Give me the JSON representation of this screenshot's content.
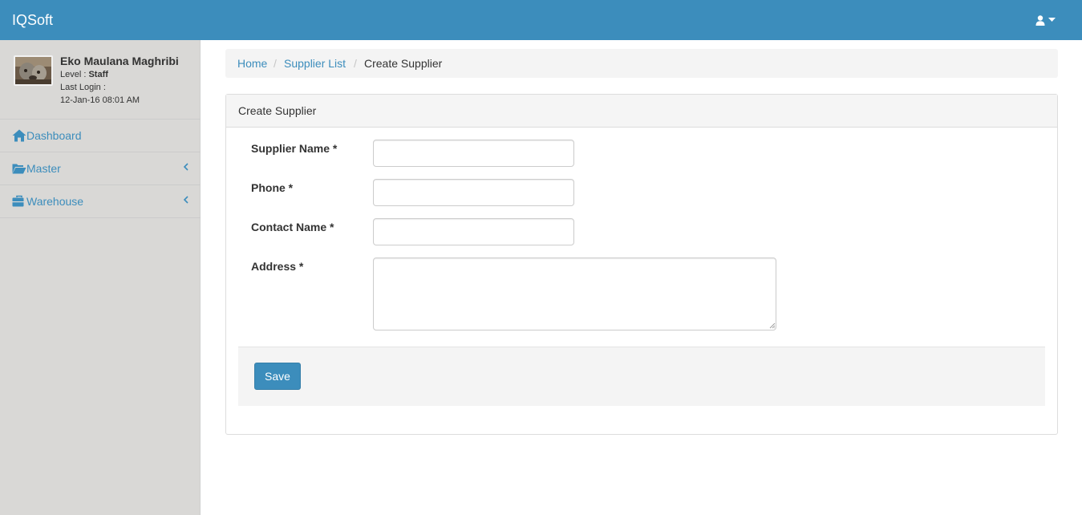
{
  "app": {
    "brand": "IQSoft"
  },
  "header": {
    "user_menu_icon": "user-icon",
    "caret_icon": "caret-down-icon"
  },
  "user": {
    "name": "Eko Maulana Maghribi",
    "level_label": "Level : ",
    "level_value": "Staff",
    "last_login_label": "Last Login :",
    "last_login_value": "12-Jan-16 08:01 AM"
  },
  "sidebar": {
    "items": [
      {
        "label": "Dashboard",
        "icon": "home-icon"
      },
      {
        "label": "Master",
        "icon": "folder-open-icon"
      },
      {
        "label": "Warehouse",
        "icon": "briefcase-icon"
      }
    ]
  },
  "breadcrumb": {
    "items": [
      "Home",
      "Supplier List",
      "Create Supplier"
    ],
    "separator": "/"
  },
  "panel": {
    "title": "Create Supplier"
  },
  "form": {
    "fields": [
      {
        "label": "Supplier Name *",
        "value": ""
      },
      {
        "label": "Phone *",
        "value": ""
      },
      {
        "label": "Contact Name *",
        "value": ""
      },
      {
        "label": "Address *",
        "value": ""
      }
    ],
    "save_label": "Save"
  },
  "colors": {
    "primary": "#3c8dbc",
    "sidebar_bg": "#d9d8d6",
    "breadcrumb_bg": "#f4f4f4"
  }
}
